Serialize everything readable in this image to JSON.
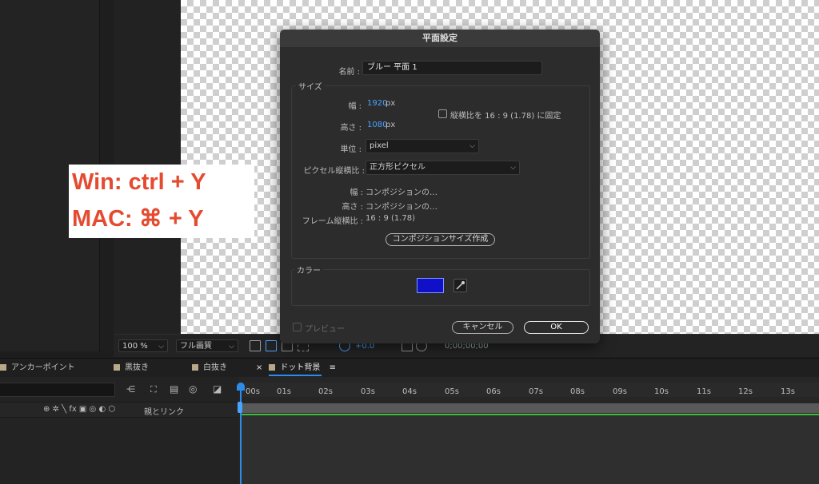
{
  "viewer": {
    "zoom": "100 %",
    "resolution": "フル画質",
    "exposure": "+0.0",
    "timecode": "0;00;00;00"
  },
  "shortcut_overlay": {
    "win_line": "Win:  ctrl + Y",
    "mac_line": "MAC: ⌘ + Y",
    "text_color": "#e44b30"
  },
  "dialog": {
    "title": "平面設定",
    "name_label": "名前 :",
    "name_value": "ブルー 平面 1",
    "size_group": {
      "title": "サイズ",
      "width_label": "幅 :",
      "width_value": "1920",
      "height_label": "高さ :",
      "height_value": "1080",
      "unit_px": "px",
      "lock_aspect_label": "縦横比を 16 : 9 (1.78) に固定",
      "lock_aspect_checked": false,
      "units_label": "単位 :",
      "units_value": "pixel",
      "pixel_aspect_label": "ピクセル縦横比 :",
      "pixel_aspect_value": "正方形ピクセル",
      "info_width_label": "幅 :",
      "info_width_value": "コンポジションの…",
      "info_height_label": "高さ :",
      "info_height_value": "コンポジションの…",
      "frame_aspect_label": "フレーム縦横比 :",
      "frame_aspect_value": "16 : 9 (1.78)",
      "make_comp_size_button": "コンポジションサイズ作成"
    },
    "color_group": {
      "title": "カラー",
      "swatch_color": "#1010c8"
    },
    "preview_label": "プレビュー",
    "cancel_button": "キャンセル",
    "ok_button": "OK"
  },
  "tabs": [
    {
      "label": "アンカーポイント",
      "active": false
    },
    {
      "label": "黒抜き",
      "active": false
    },
    {
      "label": "白抜き",
      "active": false
    },
    {
      "label": "ドット背景",
      "active": true
    }
  ],
  "tab_close": "×",
  "tab_menu": "≡",
  "timeline": {
    "parent_link_label": "親とリンク",
    "column_switches": "⊕ ✲ ╲ fx ▣ ◎ ◐ ⬡",
    "ruler_ticks": [
      "00s",
      "01s",
      "02s",
      "03s",
      "04s",
      "05s",
      "06s",
      "07s",
      "08s",
      "09s",
      "10s",
      "11s",
      "12s",
      "13s"
    ]
  }
}
